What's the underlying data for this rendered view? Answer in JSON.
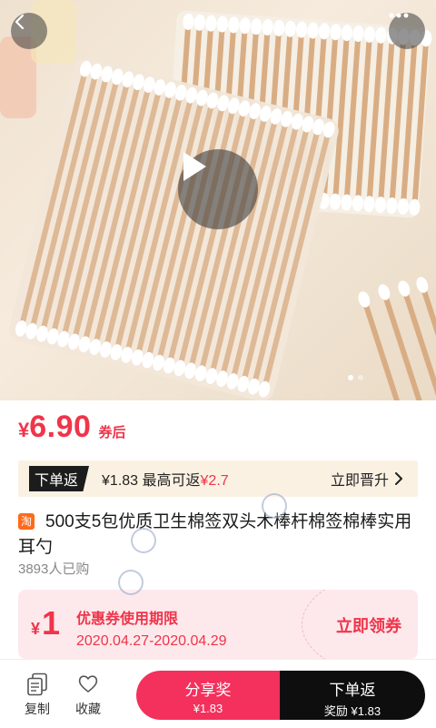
{
  "hero": {
    "back_icon": "chevron-left-icon",
    "more_icon": "more-dots-icon",
    "play_icon": "play-icon"
  },
  "price": {
    "currency": "¥",
    "value": "6.90",
    "tag": "券后"
  },
  "rebate": {
    "badge": "下单返",
    "amount": "¥1.83",
    "max_label": "最高可返",
    "max_amount": "¥2.7",
    "action": "立即晋升"
  },
  "product": {
    "platform_icon_text": "淘",
    "title": "500支5包优质卫生棉签双头木棒杆棉签棉棒实用耳勺",
    "sold": "3893人已购"
  },
  "coupon": {
    "currency": "¥",
    "amount": "1",
    "title": "优惠券使用期限",
    "period": "2020.04.27-2020.04.29",
    "action": "立即领券"
  },
  "bottom_bar": {
    "copy_label": "复制",
    "fav_label": "收藏",
    "share_label": "分享奖",
    "share_amount": "¥1.83",
    "order_label": "下单返",
    "order_amount": "奖励 ¥1.83"
  },
  "colors": {
    "accent_red": "#f0344a",
    "share_button": "#f4305c",
    "order_button": "#0e0e0e",
    "rebate_bg": "#fbf1e3",
    "coupon_bg": "#fde9ec"
  }
}
